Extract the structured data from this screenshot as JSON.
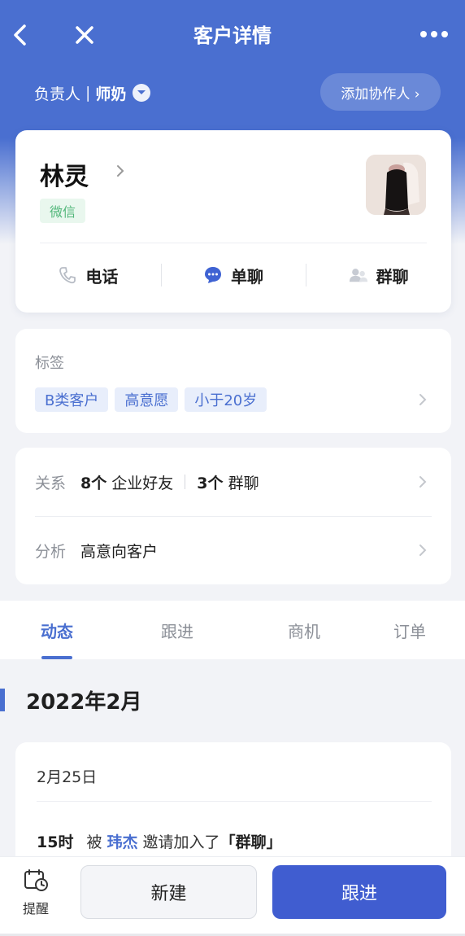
{
  "nav": {
    "title": "客户详情"
  },
  "owner": {
    "label": "负责人",
    "separator": "|",
    "name": "师奶",
    "add_collaborator": "添加协作人 ›"
  },
  "customer": {
    "name": "林灵",
    "source_tag": "微信",
    "actions": [
      {
        "label": "电话",
        "icon": "phone-icon"
      },
      {
        "label": "单聊",
        "icon": "chat-bubble-icon"
      },
      {
        "label": "群聊",
        "icon": "group-icon"
      }
    ]
  },
  "tags": {
    "label": "标签",
    "items": [
      "B类客户",
      "高意愿",
      "小于20岁"
    ]
  },
  "relations": {
    "relation_label": "关系",
    "friends_count": "8个",
    "friends_text": " 企业好友",
    "groups_count": "3个",
    "groups_text": " 群聊",
    "analysis_label": "分析",
    "analysis_value": "高意向客户"
  },
  "tabs": [
    {
      "label": "动态",
      "active": true
    },
    {
      "label": "跟进",
      "active": false
    },
    {
      "label": "商机",
      "active": false
    },
    {
      "label": "订单",
      "active": false
    }
  ],
  "feed": {
    "month": "2022年2月",
    "date": "2月25日",
    "item": {
      "hour": "15时",
      "pre": "被 ",
      "who": "玮杰",
      "mid": " 邀请加入了",
      "target": "「群聊」"
    }
  },
  "bottom": {
    "remind_label": "提醒",
    "new_label": "新建",
    "follow_label": "跟进"
  },
  "colors": {
    "primary": "#4a6fd0",
    "button": "#405dd0",
    "wechat_tag_bg": "#e9f7ee",
    "wechat_tag_text": "#52b77a"
  }
}
